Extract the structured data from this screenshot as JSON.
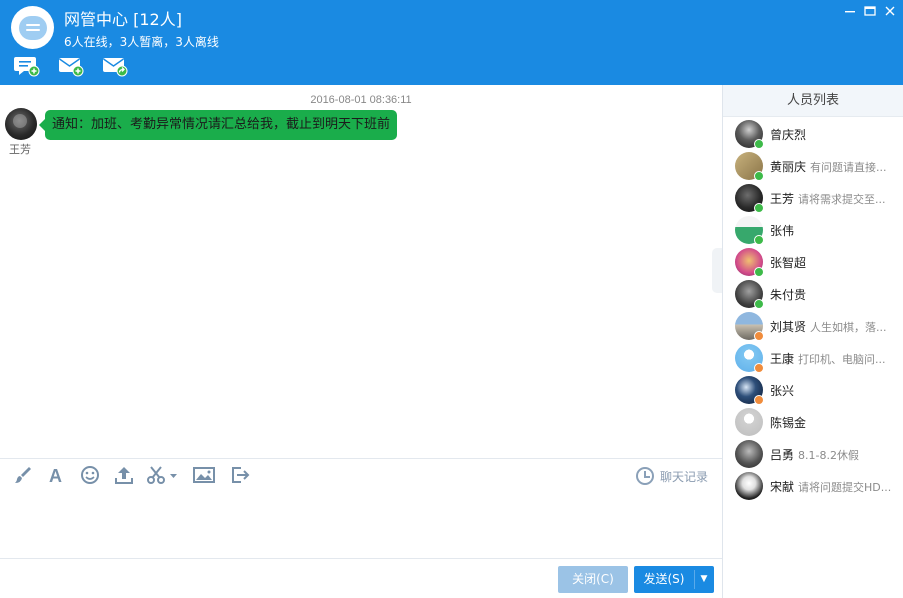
{
  "window": {
    "title": "网管中心 [12人]",
    "subtitle": "6人在线，3人暂离，3人离线",
    "minimize_icon": "minimize-icon",
    "maximize_icon": "maximize-icon",
    "close_icon": "close-icon"
  },
  "colors": {
    "header_bg": "#1a8ae2",
    "bubble_bg": "#1aad4b",
    "online": "#3dba49",
    "away": "#f08c3c",
    "send_button": "#1a8ae2",
    "close_button": "#9bc3e6"
  },
  "header_actions": [
    {
      "icon": "new-chat-icon"
    },
    {
      "icon": "new-mail-icon"
    },
    {
      "icon": "forward-mail-icon"
    }
  ],
  "chat": {
    "timestamp": "2016-08-01 08:36:11",
    "messages": [
      {
        "sender": "王芳",
        "text": "通知：加班、考勤异常情况请汇总给我，截止到明天下班前"
      }
    ]
  },
  "toolbar": {
    "tools": [
      {
        "name": "brush-icon",
        "glyph": "🖌"
      },
      {
        "name": "font-icon",
        "glyph": "A"
      },
      {
        "name": "emoji-icon",
        "glyph": "☺"
      },
      {
        "name": "upload-icon",
        "glyph": "⇪"
      },
      {
        "name": "screenshot-scissors-icon",
        "glyph": "✂▾"
      },
      {
        "name": "image-icon",
        "glyph": "▣"
      },
      {
        "name": "exit-share-icon",
        "glyph": "⇥"
      }
    ],
    "history_label": "聊天记录"
  },
  "buttons": {
    "close_label": "关闭(C)",
    "send_label": "发送(S)",
    "send_dropdown_glyph": "▼"
  },
  "members_panel": {
    "title": "人员列表",
    "members": [
      {
        "name": "曾庆烈",
        "signature": "",
        "status": "online"
      },
      {
        "name": "黄丽庆",
        "signature": "有问题请直接...",
        "status": "online"
      },
      {
        "name": "王芳",
        "signature": "请将需求提交至...",
        "status": "online"
      },
      {
        "name": "张伟",
        "signature": "",
        "status": "online"
      },
      {
        "name": "张智超",
        "signature": "",
        "status": "online"
      },
      {
        "name": "朱付贵",
        "signature": "",
        "status": "online"
      },
      {
        "name": "刘其贤",
        "signature": "人生如棋，落...",
        "status": "away"
      },
      {
        "name": "王康",
        "signature": "打印机、电脑问...",
        "status": "away"
      },
      {
        "name": "张兴",
        "signature": "",
        "status": "away"
      },
      {
        "name": "陈锡金",
        "signature": "",
        "status": "offline"
      },
      {
        "name": "吕勇",
        "signature": "8.1-8.2休假",
        "status": "offline"
      },
      {
        "name": "宋献",
        "signature": "请将问题提交HD...",
        "status": "offline"
      }
    ]
  }
}
